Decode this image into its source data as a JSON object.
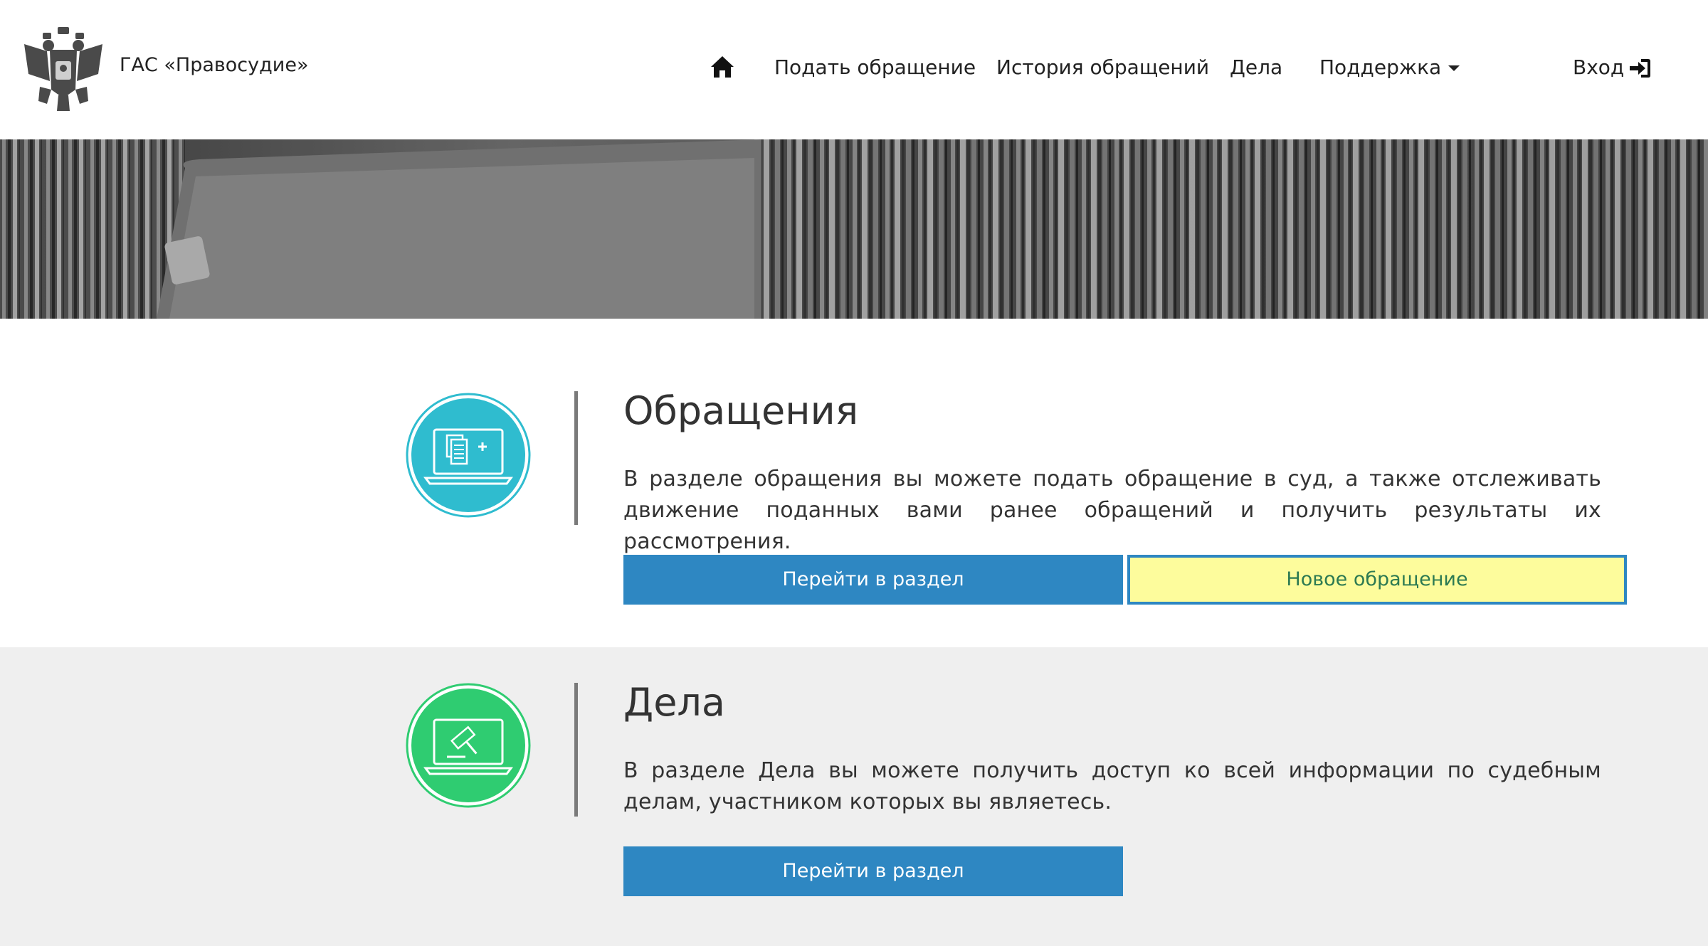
{
  "header": {
    "brand": "ГАС «Правосудие»",
    "nav": {
      "submit": "Подать обращение",
      "history": "История обращений",
      "cases": "Дела",
      "support": "Поддержка",
      "login": "Вход"
    }
  },
  "appeals": {
    "title": "Обращения",
    "text": "В разделе обращения вы можете подать обращение в суд, а также отслеживать движение поданных вами ранее обращений и получить результаты их рассмотрения.",
    "go_button": "Перейти в раздел",
    "new_button": "Новое обращение"
  },
  "cases": {
    "title": "Дела",
    "text": "В разделе Дела вы можете получить доступ ко всей информации по судебным делам, участником которых вы являетесь.",
    "go_button": "Перейти в раздел"
  },
  "colors": {
    "primary": "#2e87c2",
    "appeals_icon": "#2fbccf",
    "cases_icon": "#2fcc71",
    "highlight": "#fdfc9c"
  },
  "icons": {
    "home": "home-icon",
    "support_caret": "caret-down-icon",
    "login": "sign-in-icon",
    "appeals": "laptop-document-icon",
    "cases": "laptop-gavel-icon",
    "emblem": "coat-of-arms-emblem"
  }
}
